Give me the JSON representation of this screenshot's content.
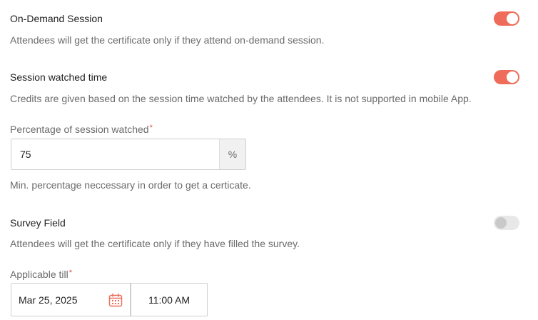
{
  "sections": {
    "on_demand": {
      "title": "On-Demand Session",
      "description": "Attendees will get the certificate only if they attend on-demand session.",
      "enabled": true
    },
    "watched_time": {
      "title": "Session watched time",
      "description": "Credits are given based on the session time watched by the attendees. It is not supported in mobile App.",
      "enabled": true
    },
    "percentage": {
      "label": "Percentage of session watched",
      "required_mark": "*",
      "value": "75",
      "unit": "%",
      "help": "Min. percentage neccessary in order to get a certicate."
    },
    "survey": {
      "title": "Survey Field",
      "description": "Attendees will get the certificate only if they have filled the survey.",
      "enabled": false
    },
    "applicable_till": {
      "label": "Applicable till",
      "required_mark": "*",
      "date": "Mar 25, 2025",
      "time": "11:00 AM",
      "icon": "calendar-icon"
    }
  },
  "colors": {
    "accent": "#ee6c59",
    "required": "#e24a3b"
  }
}
